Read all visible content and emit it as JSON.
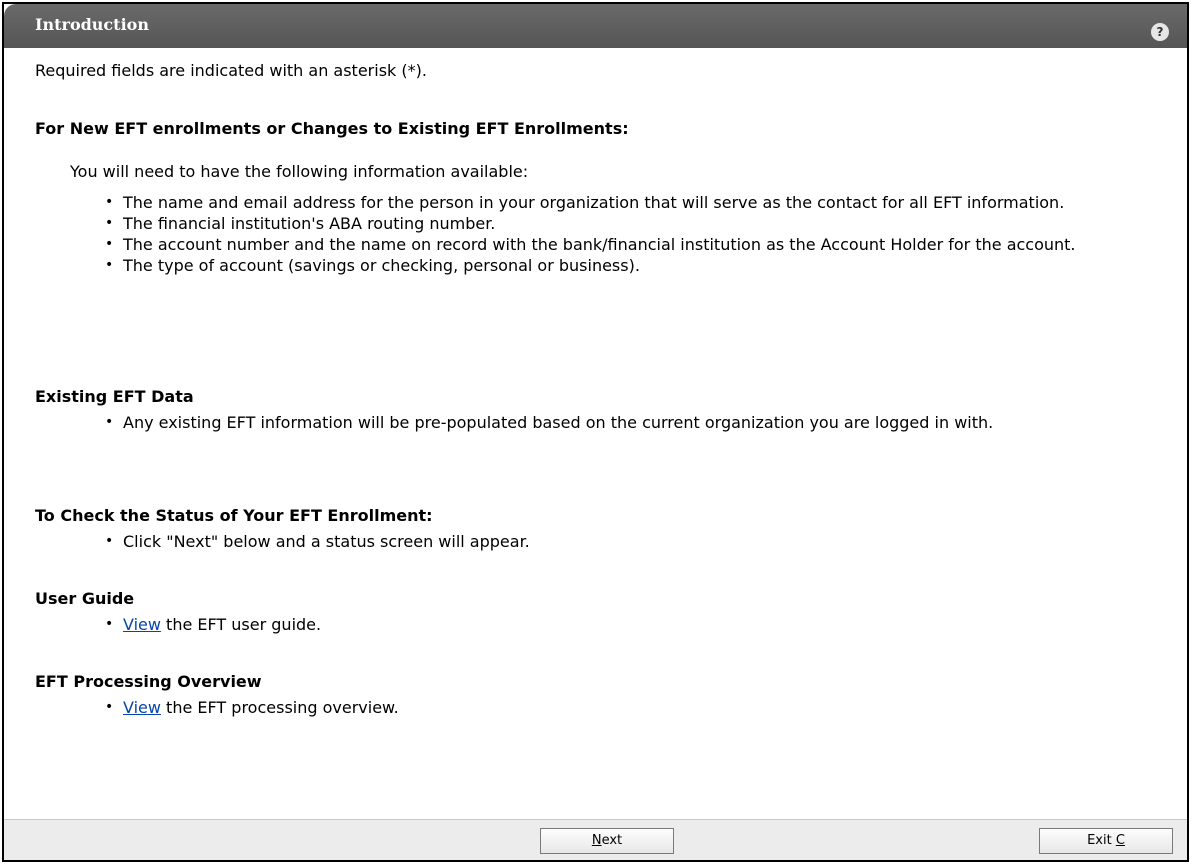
{
  "header": {
    "title": "Introduction",
    "help_icon": "?"
  },
  "required_note": "Required fields are indicated with an asterisk (*).",
  "sections": {
    "new_eft": {
      "heading": "For New EFT enrollments or Changes to Existing EFT Enrollments:",
      "intro": "You will need to have the following information available:",
      "items": [
        "The name and email address for the person in your organization that will serve as the contact for all EFT information.",
        "The financial institution's ABA routing number.",
        "The account number and the name on record with the bank/financial institution as the Account Holder for the account.",
        "The type of account (savings or checking, personal or business)."
      ]
    },
    "existing": {
      "heading": "Existing EFT Data",
      "items": [
        "Any existing EFT information will be pre-populated based on the current organization you are logged in with."
      ]
    },
    "status": {
      "heading": "To Check the Status of Your EFT Enrollment:",
      "items": [
        "Click \"Next\" below and a status screen will appear."
      ]
    },
    "user_guide": {
      "heading": "User Guide",
      "link": "View",
      "text": " the EFT user guide."
    },
    "processing": {
      "heading": "EFT Processing Overview",
      "link": "View",
      "text": " the EFT processing overview."
    }
  },
  "footer": {
    "next_label_prefix": "",
    "next_label_underlined": "N",
    "next_label_rest": "ext",
    "exit_label_prefix": "Exit ",
    "exit_label_underlined": "C",
    "exit_label_rest": ""
  }
}
